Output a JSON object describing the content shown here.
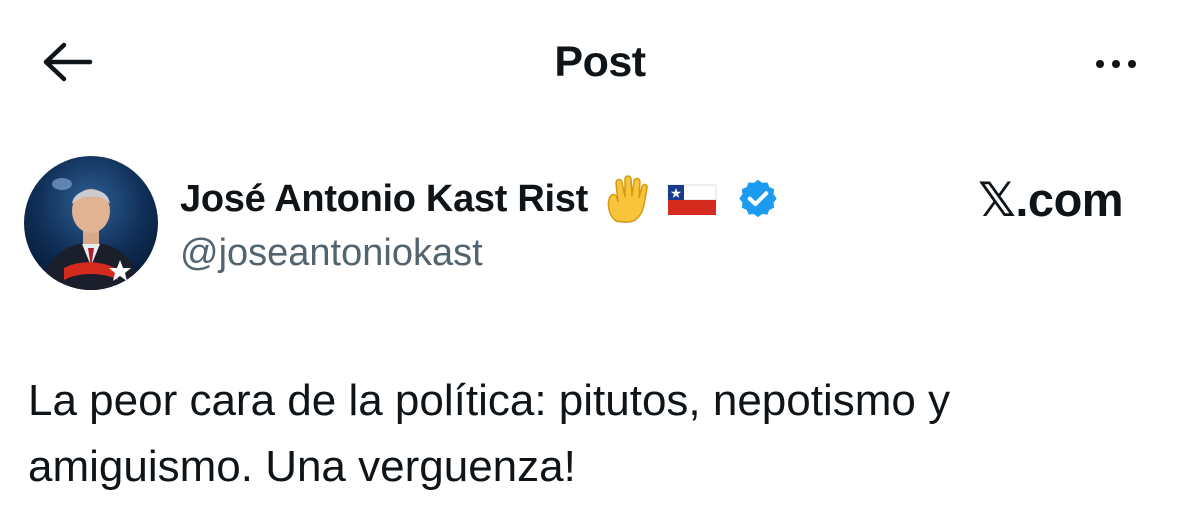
{
  "header": {
    "title": "Post",
    "back_icon": "arrow-left-icon",
    "more_icon": "more-horizontal-icon"
  },
  "author": {
    "display_name": "José Antonio Kast Rist",
    "handle": "@joseantoniokast",
    "badges": [
      "raised-hand-emoji",
      "chile-flag-emoji",
      "verified-badge-icon"
    ],
    "verified_color": "#1d9bf0"
  },
  "source": "𝕏.com",
  "post": {
    "text": "La peor cara de la política: pitutos, nepotismo y amiguismo. Una verguenza!"
  },
  "colors": {
    "text_primary": "#0f1419",
    "text_secondary": "#536471",
    "background": "#ffffff"
  }
}
